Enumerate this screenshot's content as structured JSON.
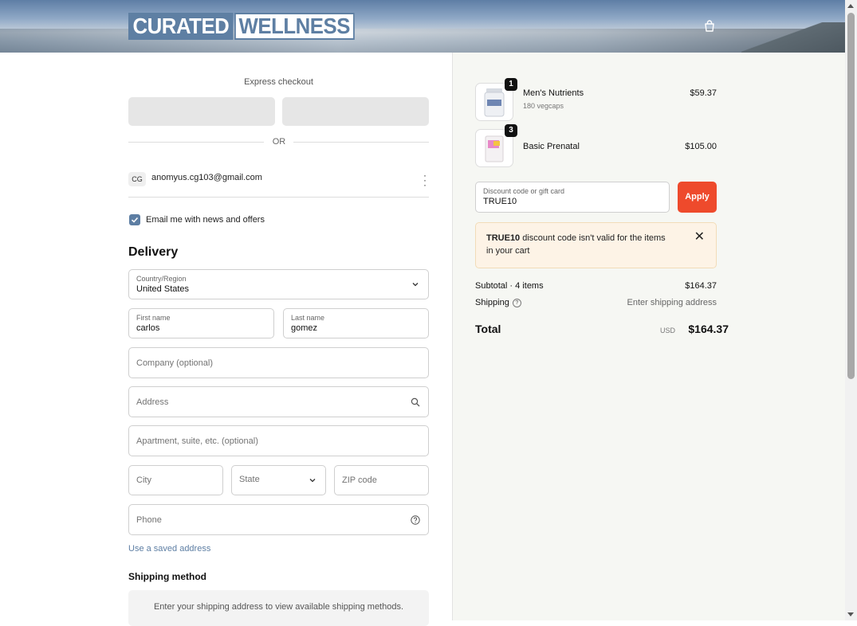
{
  "brand": {
    "word1": "CURATED",
    "word2": "WELLNESS",
    "accent": "#5d7ea3"
  },
  "express": {
    "label": "Express checkout",
    "or": "OR"
  },
  "account": {
    "initials": "CG",
    "email": "anomyus.cg103@gmail.com"
  },
  "newsletter": {
    "label": "Email me with news and offers",
    "checked": true
  },
  "delivery": {
    "heading": "Delivery",
    "country_label": "Country/Region",
    "country_value": "United States",
    "first_name_label": "First name",
    "first_name_value": "carlos",
    "last_name_label": "Last name",
    "last_name_value": "gomez",
    "company_placeholder": "Company (optional)",
    "address_placeholder": "Address",
    "apartment_placeholder": "Apartment, suite, etc. (optional)",
    "city_placeholder": "City",
    "state_placeholder": "State",
    "zip_placeholder": "ZIP code",
    "phone_placeholder": "Phone",
    "saved_address_link": "Use a saved address"
  },
  "shipping_method": {
    "heading": "Shipping method",
    "message": "Enter your shipping address to view available shipping methods."
  },
  "cart": {
    "items": [
      {
        "qty": "1",
        "name": "Men's Nutrients",
        "variant": "180 vegcaps",
        "price": "$59.37"
      },
      {
        "qty": "3",
        "name": "Basic Prenatal",
        "variant": "",
        "price": "$105.00"
      }
    ],
    "discount_label": "Discount code or gift card",
    "discount_value": "TRUE10",
    "apply_label": "Apply",
    "apply_color": "#ee4a2c",
    "alert_code": "TRUE10",
    "alert_text": " discount code isn't valid for the items in your cart",
    "subtotal_label": "Subtotal · 4 items",
    "subtotal_value": "$164.37",
    "shipping_label": "Shipping",
    "shipping_value": "Enter shipping address",
    "total_label": "Total",
    "currency": "USD",
    "total_value": "$164.37"
  }
}
